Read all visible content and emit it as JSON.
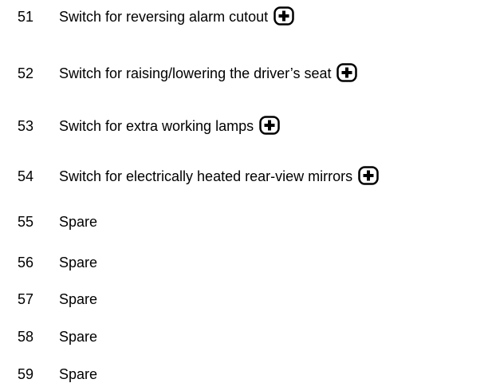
{
  "legend": {
    "items": [
      {
        "number": "51",
        "label": "Switch for reversing alarm cutout",
        "icon": "plus-box-icon"
      },
      {
        "number": "52",
        "label": "Switch for raising/lowering the driver’s seat",
        "icon": "plus-box-icon"
      },
      {
        "number": "53",
        "label": "Switch for extra working lamps",
        "icon": "plus-box-icon"
      },
      {
        "number": "54",
        "label": "Switch for electrically heated rear-view mirrors",
        "icon": "plus-box-icon"
      },
      {
        "number": "55",
        "label": "Spare"
      },
      {
        "number": "56",
        "label": "Spare"
      },
      {
        "number": "57",
        "label": "Spare"
      },
      {
        "number": "58",
        "label": "Spare"
      },
      {
        "number": "59",
        "label": "Spare"
      }
    ]
  }
}
